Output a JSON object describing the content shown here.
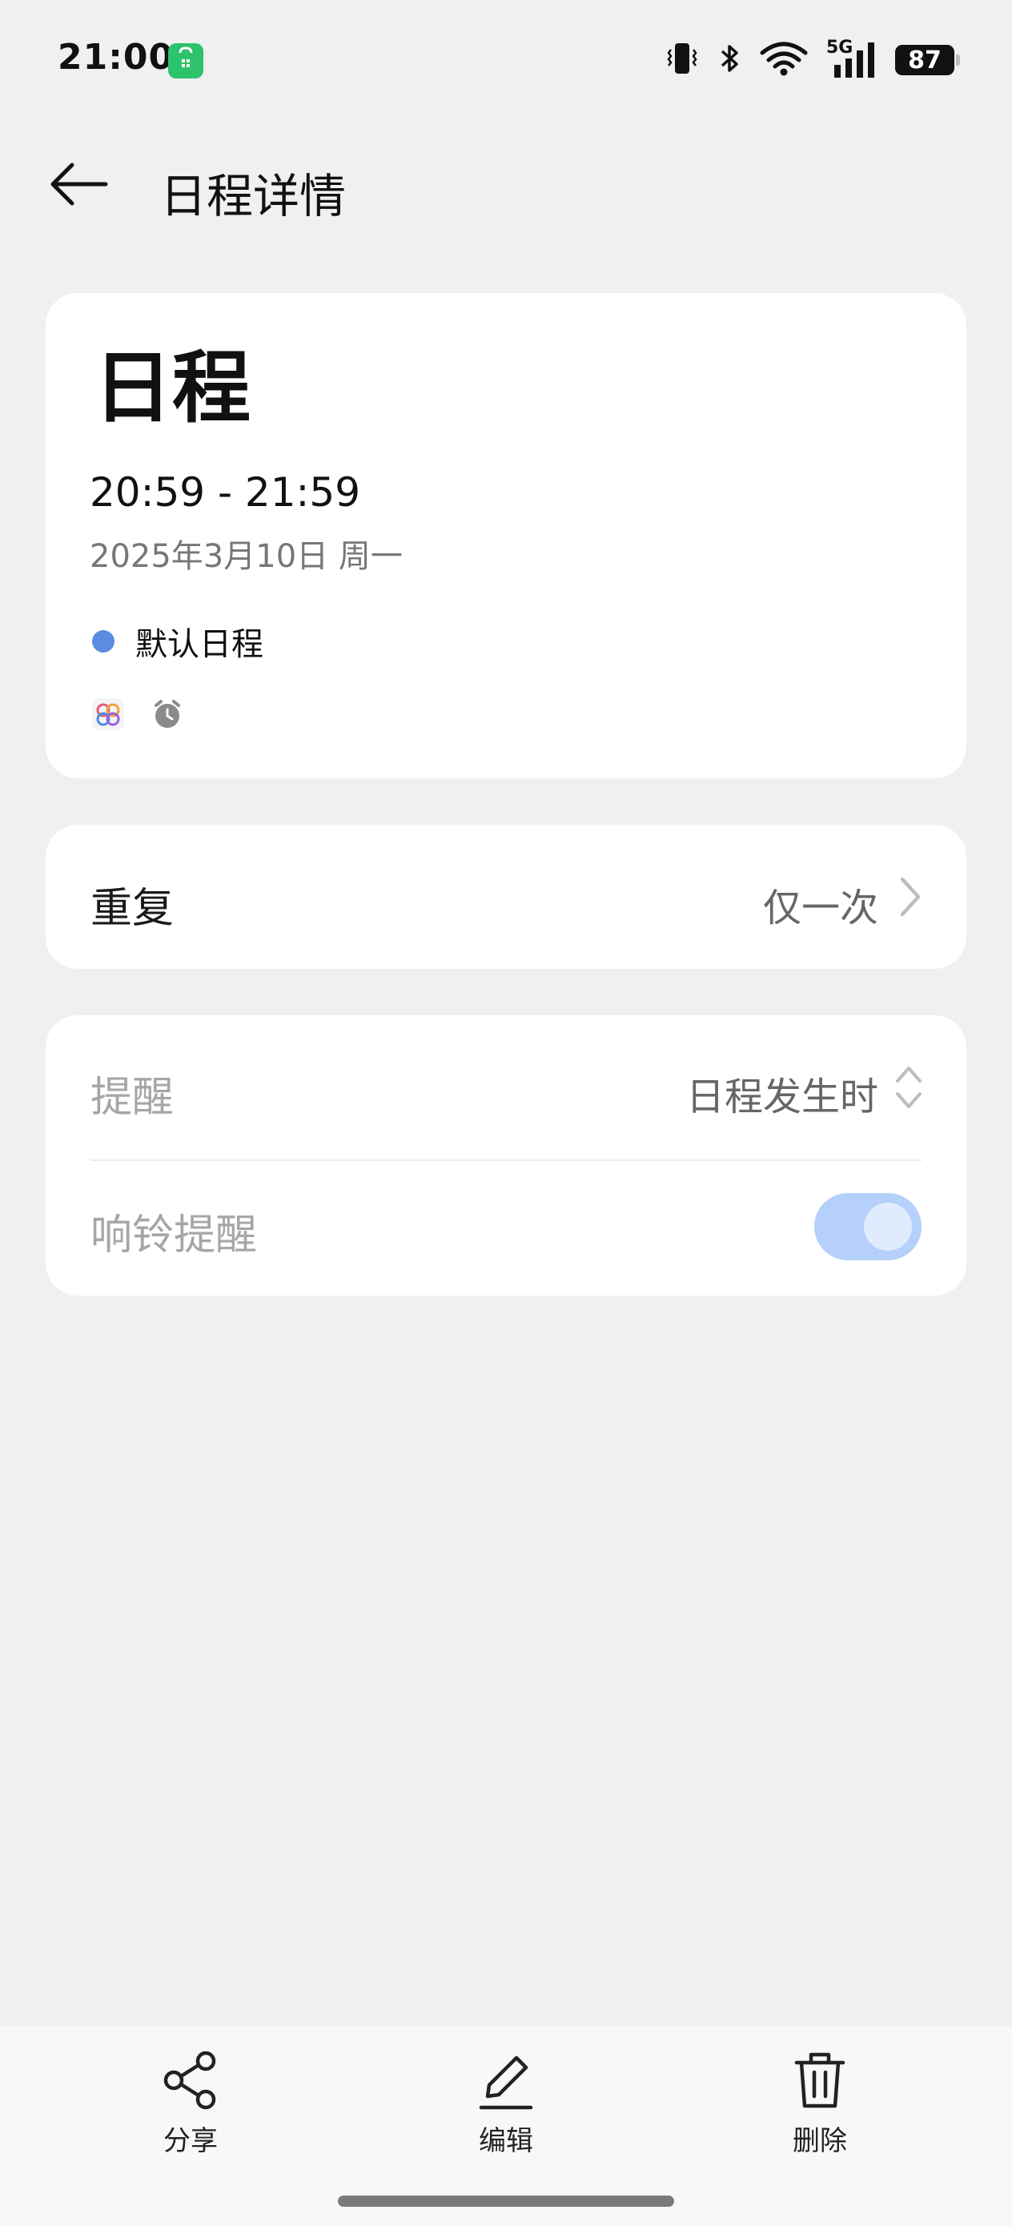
{
  "status_bar": {
    "time": "21:00",
    "network": "5G",
    "battery": "87"
  },
  "header": {
    "title": "日程详情"
  },
  "event": {
    "title": "日程",
    "time_range": "20:59 - 21:59",
    "date": "2025年3月10日 周一",
    "calendar_name": "默认日程",
    "calendar_color": "#5a8de0"
  },
  "repeat": {
    "label": "重复",
    "value": "仅一次"
  },
  "reminder": {
    "label": "提醒",
    "value": "日程发生时",
    "ring_label": "响铃提醒",
    "ring_enabled": true
  },
  "bottom_actions": {
    "share": "分享",
    "edit": "编辑",
    "delete": "删除"
  },
  "colors": {
    "background": "#eff0f2",
    "toggle_on": "#b4d0fb",
    "accent_blue": "#5a8de0"
  }
}
